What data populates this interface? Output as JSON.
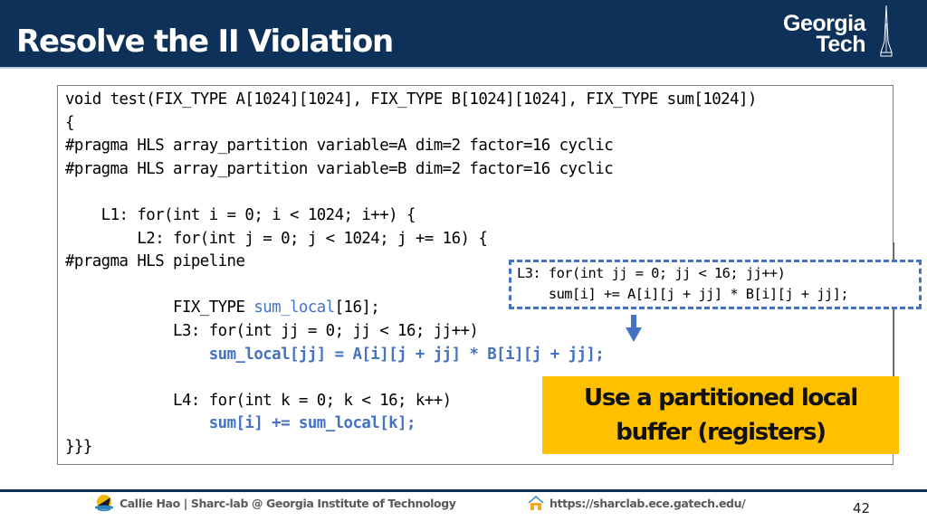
{
  "slide": {
    "title": "Resolve the II Violation",
    "logo": {
      "line1": "Georgia",
      "line2": "Tech"
    },
    "code_lines": [
      "void test(FIX_TYPE A[1024][1024], FIX_TYPE B[1024][1024], FIX_TYPE sum[1024])",
      "{",
      "#pragma HLS array_partition variable=A dim=2 factor=16 cyclic",
      "#pragma HLS array_partition variable=B dim=2 factor=16 cyclic",
      "",
      "    L1: for(int i = 0; i < 1024; i++) {",
      "        L2: for(int j = 0; j < 1024; j += 16) {",
      "#pragma HLS pipeline",
      "",
      "            FIX_TYPE |sum_local|[16];",
      "            L3: for(int jj = 0; jj < 16; jj++)",
      "                |sum_local[jj] = A[i][j + jj] * B[i][j + jj];|",
      "",
      "            L4: for(int k = 0; k < 16; k++)",
      "                |sum[i] += sum_local[k];|",
      "}}}"
    ],
    "original_code": {
      "line1": "L3: for(int jj = 0; jj < 16; jj++)",
      "line2": "    sum[i] += A[i][j + jj] * B[i][j + jj];"
    },
    "callout": {
      "line1": "Use a partitioned local",
      "line2": "buffer (registers)"
    },
    "colors": {
      "header_bg": "#0e3159",
      "highlight_code": "#4472c4",
      "callout_bg": "#ffc000"
    }
  },
  "footer": {
    "author": "Callie Hao | Sharc-lab @ Georgia Institute of Technology",
    "url": "https://sharclab.ece.gatech.edu/",
    "page_number": "42"
  }
}
